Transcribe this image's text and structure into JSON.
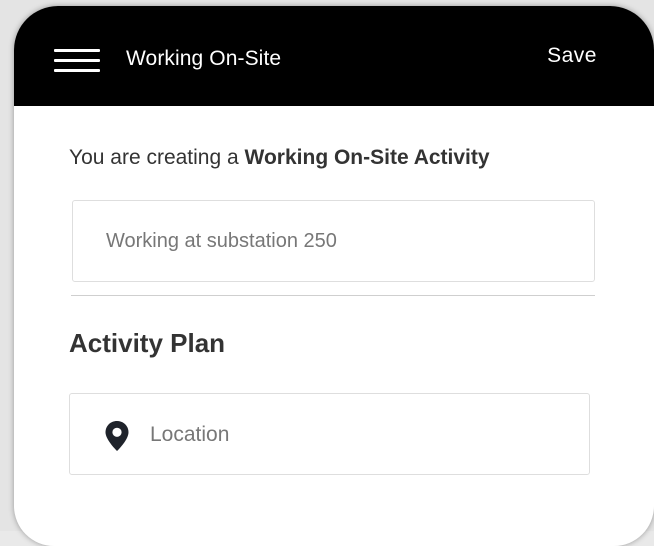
{
  "appbar": {
    "title": "Working On-Site",
    "save_label": "Save"
  },
  "form": {
    "intro_prefix": "You are creating a ",
    "intro_bold": "Working On-Site Activity",
    "name_value": "Working at substation 250",
    "section_title": "Activity Plan",
    "location_placeholder": "Location"
  },
  "icons": {
    "menu": "hamburger-menu-icon",
    "location": "map-pin-icon"
  },
  "colors": {
    "appbar": "#000000",
    "text": "#333333",
    "muted": "#777777"
  }
}
